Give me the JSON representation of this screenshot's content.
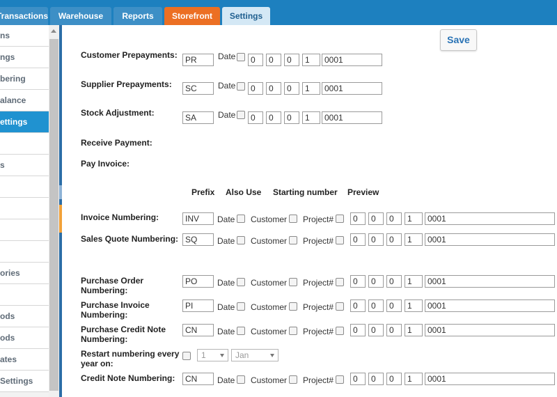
{
  "tabs": {
    "transactions": "Transactions",
    "warehouse": "Warehouse",
    "reports": "Reports",
    "storefront": "Storefront",
    "settings": "Settings"
  },
  "sidebar": {
    "items": [
      {
        "label": "ns"
      },
      {
        "label": "ngs"
      },
      {
        "label": "bering"
      },
      {
        "label": "alance"
      },
      {
        "label": "ettings"
      },
      {
        "label": ""
      },
      {
        "label": "s"
      },
      {
        "label": ""
      },
      {
        "label": ""
      },
      {
        "label": ""
      },
      {
        "label": ""
      },
      {
        "label": "ories"
      },
      {
        "label": ""
      },
      {
        "label": "ods"
      },
      {
        "label": "ods"
      },
      {
        "label": "ates"
      },
      {
        "label": "Settings"
      }
    ]
  },
  "toolbar": {
    "save_label": "Save"
  },
  "common": {
    "date": "Date",
    "customer": "Customer",
    "project": "Project#"
  },
  "simple_rows": [
    {
      "label": "Customer Prepayments:",
      "prefix": "PR",
      "digits": [
        "0",
        "0",
        "0",
        "1"
      ],
      "preview": "0001"
    },
    {
      "label": "Supplier Prepayments:",
      "prefix": "SC",
      "digits": [
        "0",
        "0",
        "0",
        "1"
      ],
      "preview": "0001"
    },
    {
      "label": "Stock Adjustment:",
      "prefix": "SA",
      "digits": [
        "0",
        "0",
        "0",
        "1"
      ],
      "preview": "0001"
    }
  ],
  "plain_labels": {
    "receive_payment": "Receive Payment:",
    "pay_invoice": "Pay Invoice:"
  },
  "headers": {
    "prefix": "Prefix",
    "also_use": "Also Use",
    "starting_number": "Starting number",
    "preview": "Preview"
  },
  "full_rows": [
    {
      "label": "Invoice Numbering:",
      "prefix": "INV",
      "digits": [
        "0",
        "0",
        "0",
        "1"
      ],
      "preview": "0001"
    },
    {
      "label": "Sales Quote Numbering:",
      "prefix": "SQ",
      "digits": [
        "0",
        "0",
        "0",
        "1"
      ],
      "preview": "0001"
    },
    {
      "label": "Purchase Order Numbering:",
      "prefix": "PO",
      "digits": [
        "0",
        "0",
        "0",
        "1"
      ],
      "preview": "0001"
    },
    {
      "label": "Purchase Invoice Numbering:",
      "prefix": "PI",
      "digits": [
        "0",
        "0",
        "0",
        "1"
      ],
      "preview": "0001"
    },
    {
      "label": "Purchase Credit Note Numbering:",
      "prefix": "CN",
      "digits": [
        "0",
        "0",
        "0",
        "1"
      ],
      "preview": "0001"
    },
    {
      "label": "Credit Note Numbering:",
      "prefix": "CN",
      "digits": [
        "0",
        "0",
        "0",
        "1"
      ],
      "preview": "0001"
    }
  ],
  "restart": {
    "label": "Restart numbering every year on:",
    "day": "1",
    "month": "Jan"
  },
  "colors": {
    "topbar": "#1d80bf",
    "tab": "#3d8fc6",
    "storefront_tab": "#ec6f23",
    "active_tab": "#d4e8f5",
    "active_sidebar": "#2092d0",
    "save_text": "#2a73b5"
  }
}
